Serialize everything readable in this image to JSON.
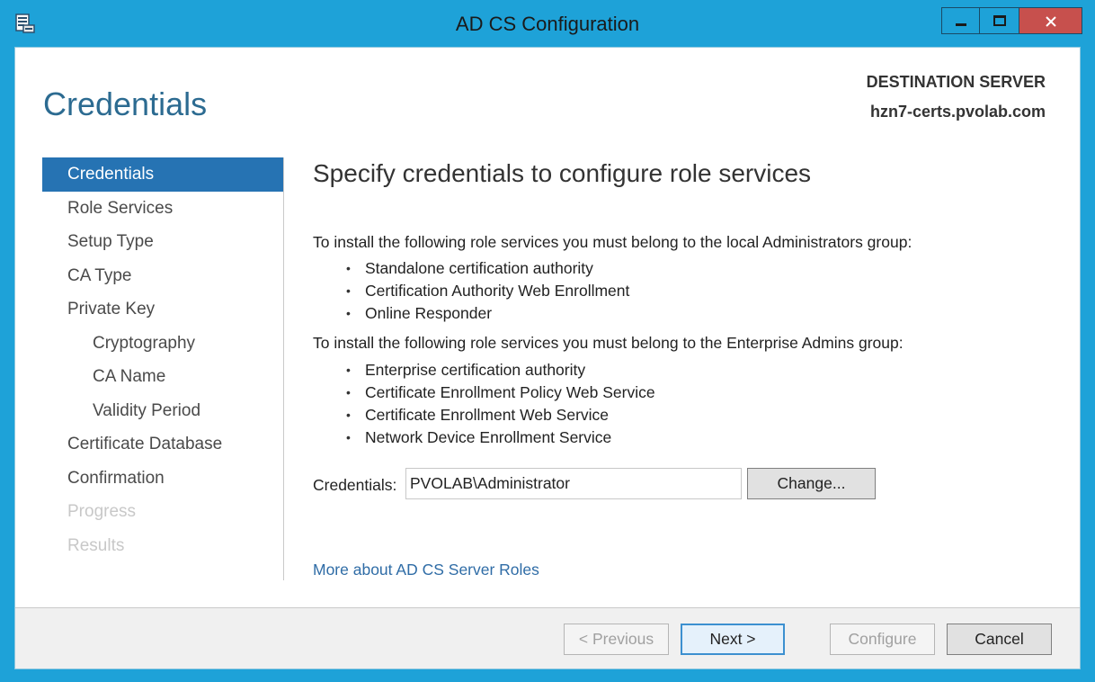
{
  "window": {
    "title": "AD CS Configuration",
    "minimize_icon": "minimize-icon",
    "maximize_icon": "maximize-icon",
    "close_color": "#c7504d"
  },
  "header": {
    "page_title": "Credentials",
    "destination_label": "DESTINATION SERVER",
    "destination_server": "hzn7-certs.pvolab.com"
  },
  "nav": {
    "items": [
      {
        "label": "Credentials",
        "state": "active"
      },
      {
        "label": "Role Services",
        "state": "normal"
      },
      {
        "label": "Setup Type",
        "state": "normal"
      },
      {
        "label": "CA Type",
        "state": "normal"
      },
      {
        "label": "Private Key",
        "state": "normal"
      },
      {
        "label": "Cryptography",
        "state": "sub"
      },
      {
        "label": "CA Name",
        "state": "sub"
      },
      {
        "label": "Validity Period",
        "state": "sub"
      },
      {
        "label": "Certificate Database",
        "state": "normal"
      },
      {
        "label": "Confirmation",
        "state": "normal"
      },
      {
        "label": "Progress",
        "state": "disabled"
      },
      {
        "label": "Results",
        "state": "disabled"
      }
    ]
  },
  "main": {
    "heading": "Specify credentials to configure role services",
    "local_admin_text": "To install the following role services you must belong to the local Administrators group:",
    "local_admin_roles": [
      "Standalone certification authority",
      "Certification Authority Web Enrollment",
      "Online Responder"
    ],
    "enterprise_admin_text": "To install the following role services you must belong to the Enterprise Admins group:",
    "enterprise_admin_roles": [
      "Enterprise certification authority",
      "Certificate Enrollment Policy Web Service",
      "Certificate Enrollment Web Service",
      "Network Device Enrollment Service"
    ],
    "credentials_label": "Credentials:",
    "credentials_value": "PVOLAB\\Administrator",
    "change_button": "Change...",
    "more_link": "More about AD CS Server Roles"
  },
  "footer": {
    "previous": "< Previous",
    "next": "Next >",
    "configure": "Configure",
    "cancel": "Cancel"
  },
  "colors": {
    "accent": "#1ea2d8",
    "nav_active": "#2673b3",
    "heading": "#2c6b91",
    "link": "#2f6ca6"
  }
}
